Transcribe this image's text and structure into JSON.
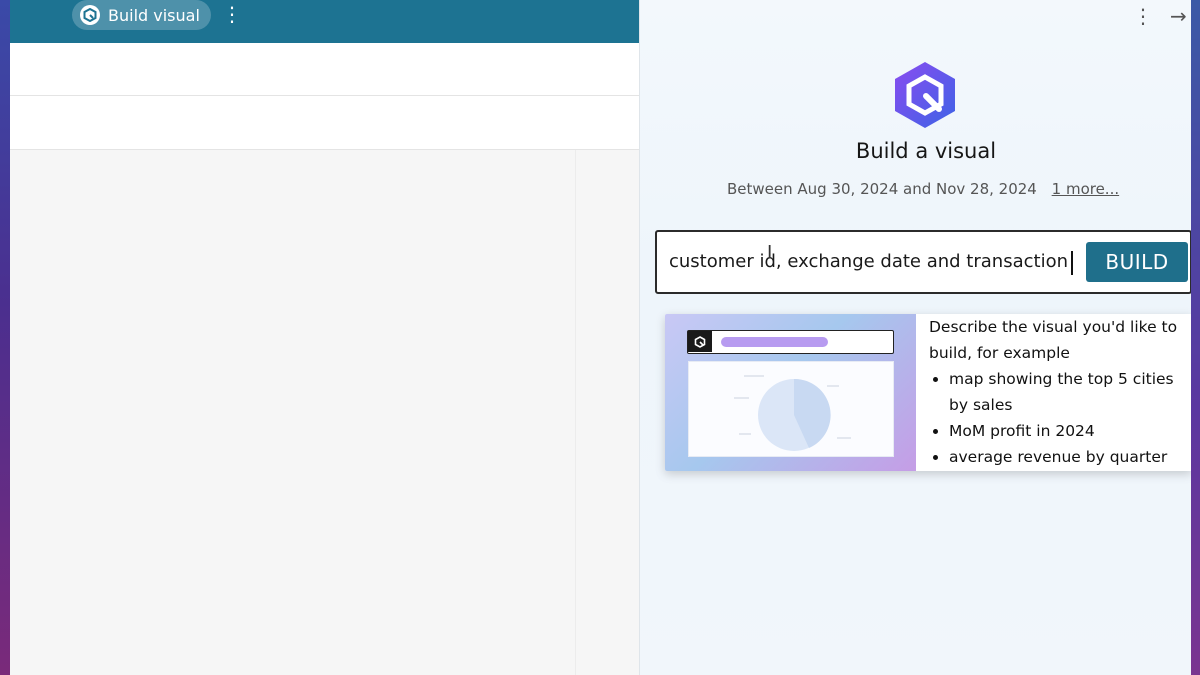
{
  "left_window": {
    "toolbar": {
      "build_visual_label": "Build visual",
      "more_icon": "vertical-ellipsis"
    }
  },
  "panel": {
    "more_icon": "vertical-ellipsis",
    "collapse_icon": "arrow-right",
    "logo_icon": "q-hexagon-logo",
    "title": "Build a visual",
    "date_range": "Between Aug 30, 2024 and Nov 28, 2024",
    "more_link": "1 more...",
    "query": {
      "value": "customer id, exchange date and transaction"
    },
    "build_button": "BUILD",
    "hint": {
      "intro": "Describe the visual you'd like to build, for example",
      "examples": [
        "map showing the top 5 cities by sales",
        "MoM profit in 2024",
        "average revenue by quarter"
      ]
    }
  },
  "colors": {
    "toolbar": "#1d7392",
    "build_button": "#1f6f8b",
    "logo_gradient_start": "#8a4cf0",
    "logo_gradient_end": "#3d63e6"
  }
}
